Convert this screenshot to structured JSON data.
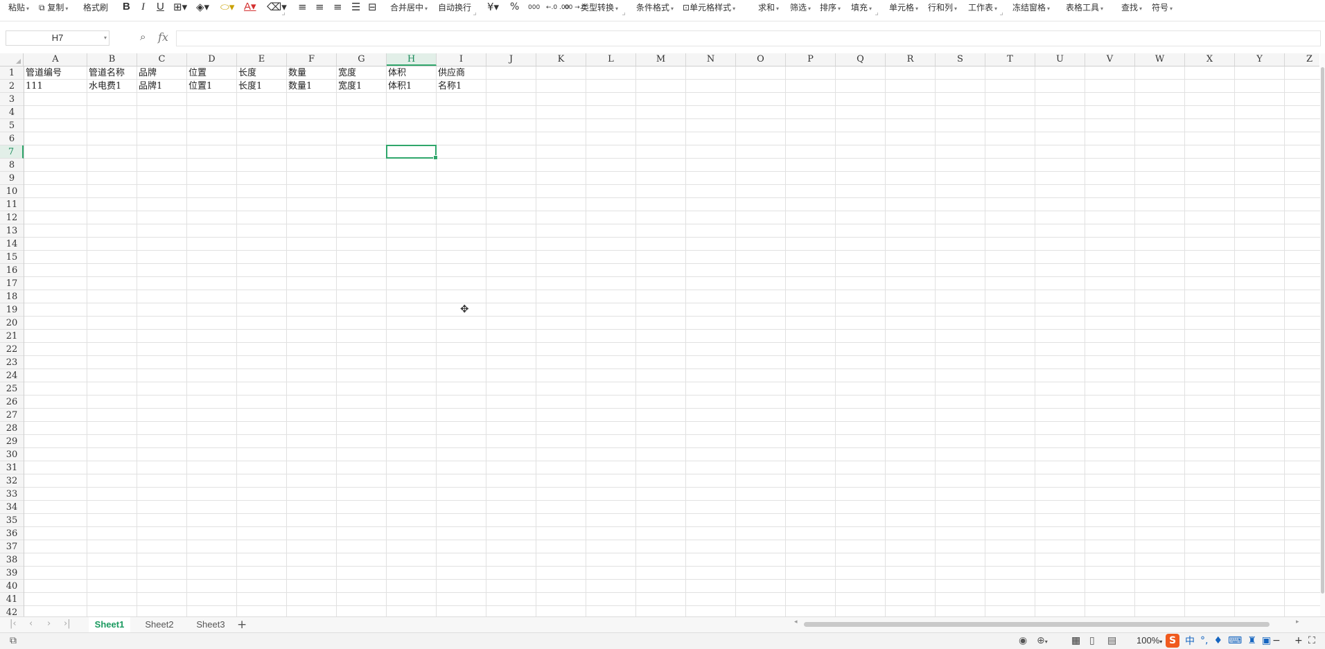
{
  "toolbar": {
    "paste": "粘贴",
    "copy": "复制",
    "format_painter": "格式刷",
    "bold": "B",
    "italic": "I",
    "underline": "U",
    "merge_center": "合并居中",
    "wrap_text": "自动换行",
    "currency": "¥",
    "percent": "%",
    "thousands": "000",
    "inc_decimal": "←.0 .00",
    "dec_decimal": ".00 →.0",
    "type_convert": "类型转换",
    "cond_format": "条件格式",
    "cell_style": "单元格样式",
    "sum": "求和",
    "filter": "筛选",
    "sort": "排序",
    "fill": "填充",
    "cell": "单元格",
    "row_col": "行和列",
    "worksheet": "工作表",
    "freeze": "冻结窗格",
    "table_tools": "表格工具",
    "find": "查找",
    "symbol": "符号"
  },
  "formula_bar": {
    "name_box": "H7",
    "fx": "fx",
    "formula": ""
  },
  "columns": [
    "A",
    "B",
    "C",
    "D",
    "E",
    "F",
    "G",
    "H",
    "I",
    "J",
    "K",
    "L",
    "M",
    "N",
    "O",
    "P",
    "Q",
    "R",
    "S",
    "T",
    "U",
    "V",
    "W",
    "X",
    "Y",
    "Z"
  ],
  "rows": [
    "1",
    "2",
    "3",
    "4",
    "5",
    "6",
    "7",
    "8",
    "9",
    "10",
    "11",
    "12",
    "13",
    "14",
    "15",
    "16",
    "17",
    "18",
    "19",
    "20",
    "21",
    "22",
    "23",
    "24",
    "25",
    "26",
    "27",
    "28",
    "29",
    "30",
    "31",
    "32",
    "33",
    "34",
    "35",
    "36",
    "37",
    "38",
    "39",
    "40",
    "41",
    "42"
  ],
  "cells": {
    "r1": [
      "管道编号",
      "管道名称",
      "品牌",
      "位置",
      "长度",
      "数量",
      "宽度",
      "体积",
      "供应商"
    ],
    "r2": [
      "111",
      "水电费1",
      "品牌1",
      "位置1",
      "长度1",
      "数量1",
      "宽度1",
      "体积1",
      "名称1"
    ]
  },
  "selection": {
    "column": "H",
    "row": "7"
  },
  "sheets": {
    "tabs": [
      "Sheet1",
      "Sheet2",
      "Sheet3"
    ],
    "active": "Sheet1",
    "add": "+"
  },
  "status": {
    "zoom": "100%",
    "ime_logo": "S",
    "ime_mode": "中"
  },
  "colors": {
    "accent": "#2fa66b",
    "sheet_tab_active": "#1a9a5f",
    "ime_brand": "#f05a1e"
  }
}
